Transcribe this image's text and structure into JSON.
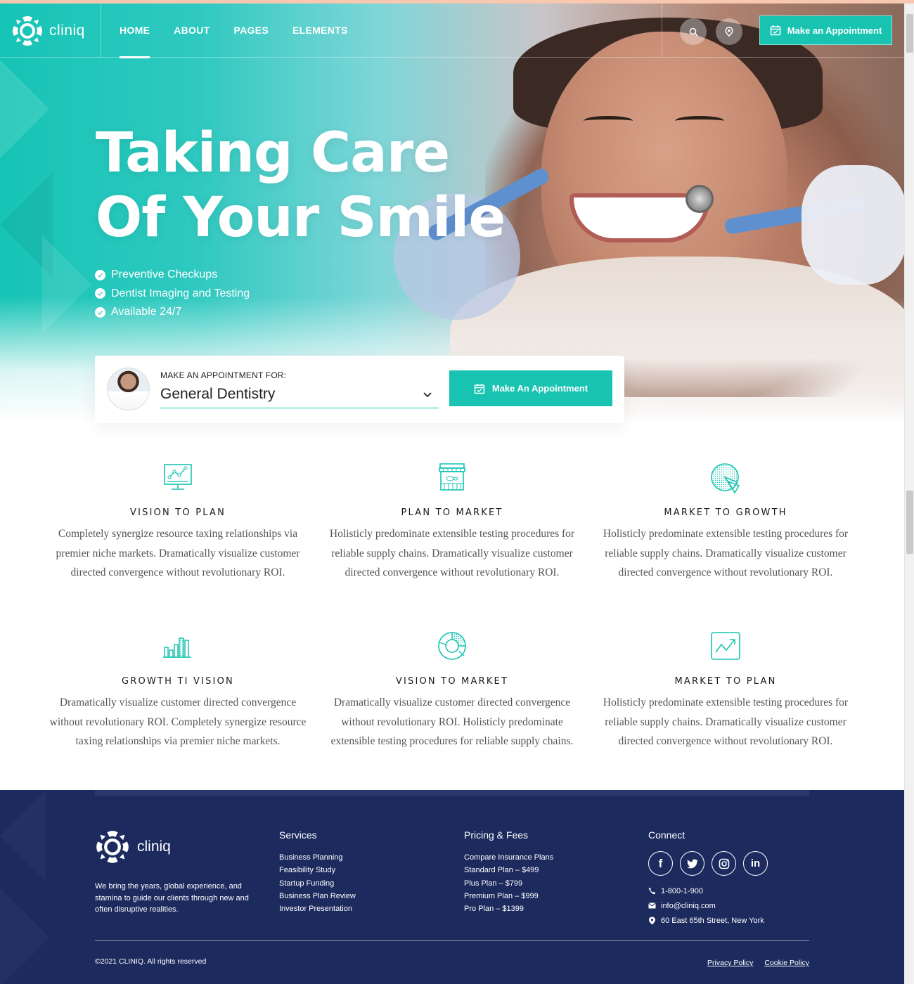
{
  "brand": {
    "name": "cliniq"
  },
  "nav": {
    "items": [
      {
        "label": "HOME",
        "active": true
      },
      {
        "label": "ABOUT"
      },
      {
        "label": "PAGES"
      },
      {
        "label": "ELEMENTS"
      }
    ],
    "search_icon": "search-icon",
    "location_icon": "location-pin-icon",
    "cta_label": "Make an Appointment",
    "cta_icon": "calendar-icon"
  },
  "hero": {
    "title_line1": "Taking Care",
    "title_line2": "Of Your Smile",
    "checklist": [
      "Preventive Checkups",
      "Dentist Imaging and Testing",
      "Available 24/7"
    ]
  },
  "appointment": {
    "label": "MAKE AN APPOINTMENT FOR:",
    "selected": "General Dentistry",
    "button_label": "Make An Appointment"
  },
  "features": [
    {
      "icon": "monitor-chart-icon",
      "title": "VISION TO PLAN",
      "text": "Completely synergize resource taxing relationships via premier niche markets. Dramatically visualize customer directed convergence without revolutionary ROI."
    },
    {
      "icon": "storefront-icon",
      "title": "PLAN TO MARKET",
      "text": "Holisticly predominate extensible testing procedures for reliable supply chains. Dramatically visualize customer directed convergence without revolutionary ROI."
    },
    {
      "icon": "pie-chart-icon",
      "title": "MARKET TO GROWTH",
      "text": "Holisticly predominate extensible testing procedures for reliable supply chains. Dramatically visualize customer directed convergence without revolutionary ROI."
    },
    {
      "icon": "bar-chart-icon",
      "title": "GROWTH TI VISION",
      "text": "Dramatically visualize customer directed convergence without revolutionary ROI. Completely synergize resource taxing relationships via premier niche markets."
    },
    {
      "icon": "donut-chart-icon",
      "title": "VISION TO MARKET",
      "text": "Dramatically visualize customer directed convergence without revolutionary ROI. Holisticly predominate extensible testing procedures for reliable supply chains."
    },
    {
      "icon": "trend-line-icon",
      "title": "MARKET TO PLAN",
      "text": "Holisticly predominate extensible testing procedures for reliable supply chains. Dramatically visualize customer directed convergence without revolutionary ROI."
    }
  ],
  "footer": {
    "about": "We bring the years, global experience, and stamina to guide our clients through new and often disruptive realities.",
    "services": {
      "heading": "Services",
      "items": [
        "Business Planning",
        "Feasibility Study",
        "Startup Funding",
        "Business Plan Review",
        "Investor Presentation"
      ]
    },
    "pricing": {
      "heading": "Pricing & Fees",
      "items": [
        "Compare Insurance Plans",
        "Standard Plan – $499",
        "Plus Plan – $799",
        "Premium Plan – $999",
        "Pro Plan – $1399"
      ]
    },
    "connect": {
      "heading": "Connect",
      "social": [
        {
          "icon": "facebook-icon",
          "glyph": "f"
        },
        {
          "icon": "twitter-icon",
          "glyph": ""
        },
        {
          "icon": "instagram-icon",
          "glyph": ""
        },
        {
          "icon": "linkedin-icon",
          "glyph": "in"
        }
      ],
      "phone": "1-800-1-900",
      "email": "info@cliniq.com",
      "address": "60 East 65th Street, New York"
    },
    "copyright": "©2021 CLINIQ. All rights reserved",
    "links": [
      "Privacy Policy",
      "Cookie Policy"
    ]
  },
  "colors": {
    "accent": "#18c4b1",
    "footer_bg": "#1c2a5e"
  }
}
